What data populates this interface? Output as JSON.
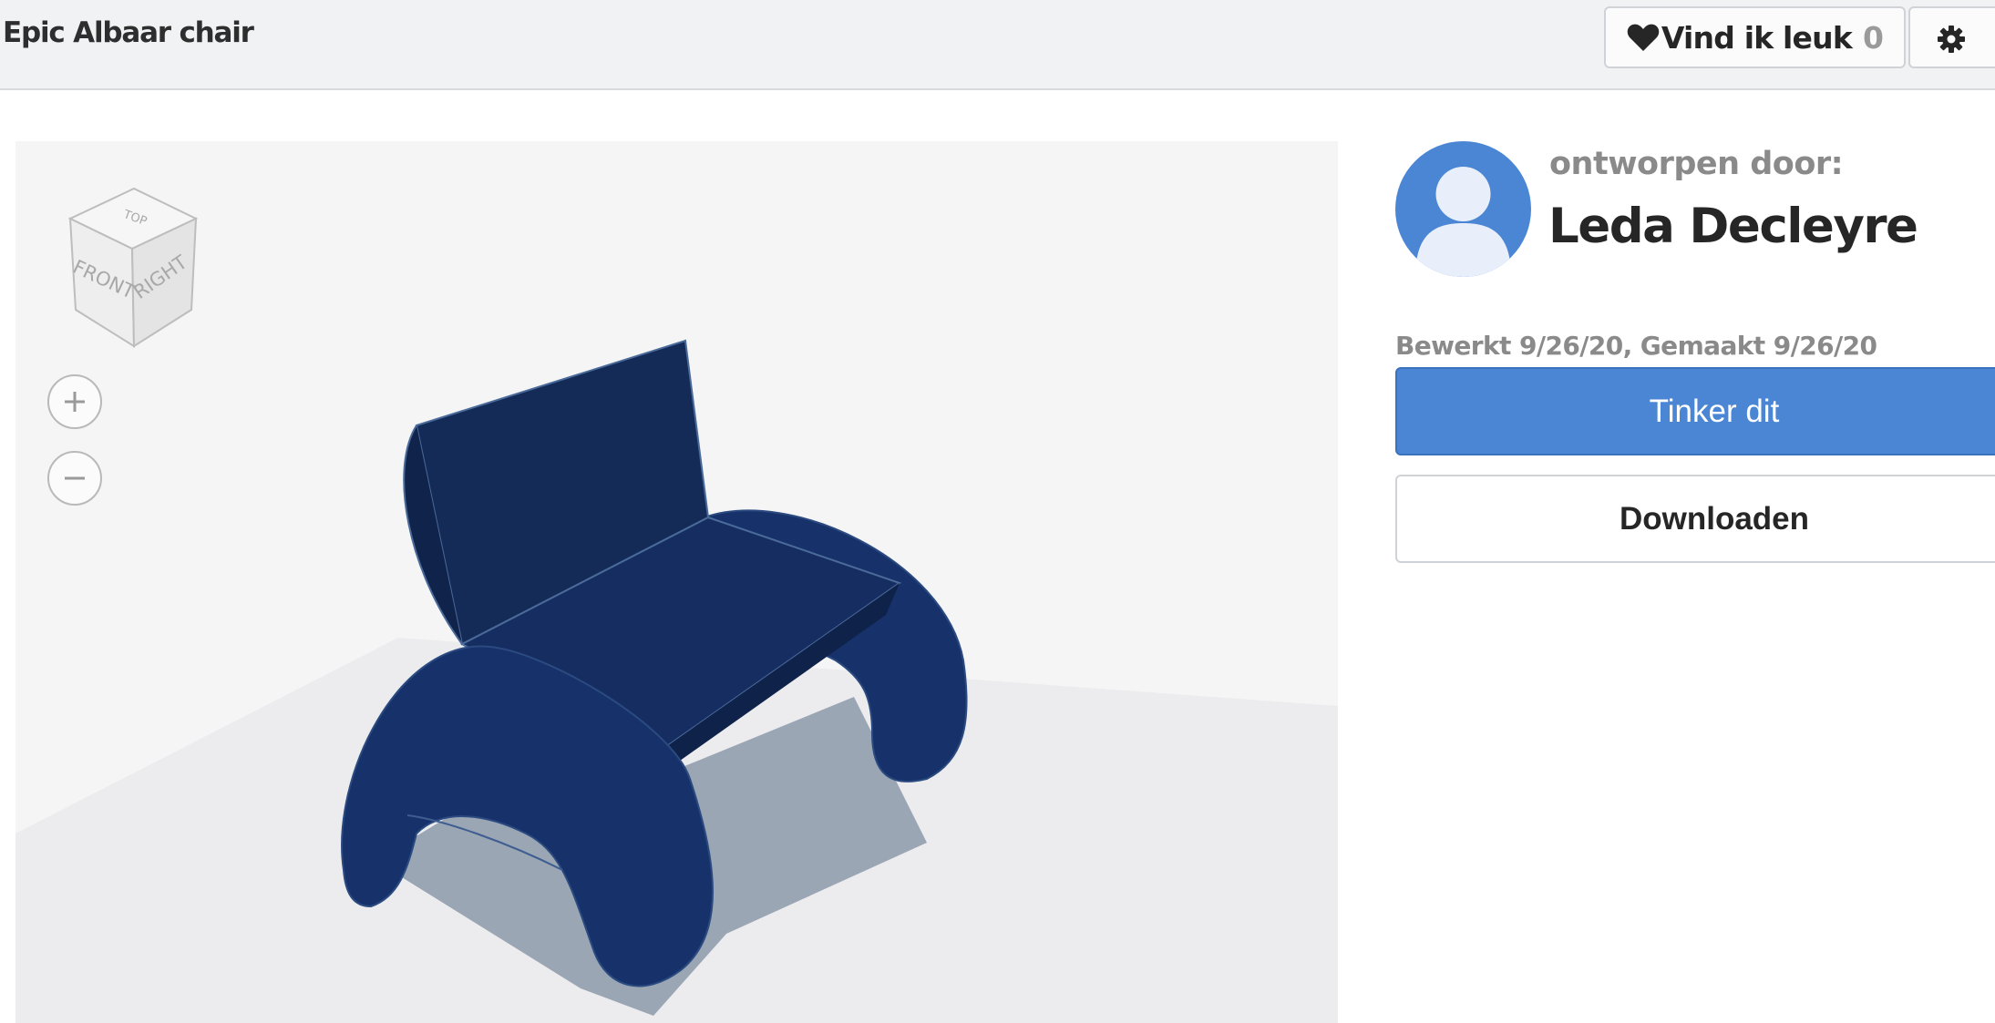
{
  "header": {
    "title": "Epic Albaar chair",
    "like_label": "Vind ik leuk",
    "like_count": "0"
  },
  "viewer": {
    "view_cube": {
      "top": "TOP",
      "front": "FRONT",
      "right": "RIGHT"
    }
  },
  "designer": {
    "designed_by_label": "ontworpen door:",
    "name": "Leda Decleyre",
    "dates": "Bewerkt 9/26/20, Gemaakt 9/26/20"
  },
  "actions": {
    "tinker_label": "Tinker dit",
    "download_label": "Downloaden"
  },
  "colors": {
    "accent": "#4a86d4",
    "model": "#142a57"
  }
}
